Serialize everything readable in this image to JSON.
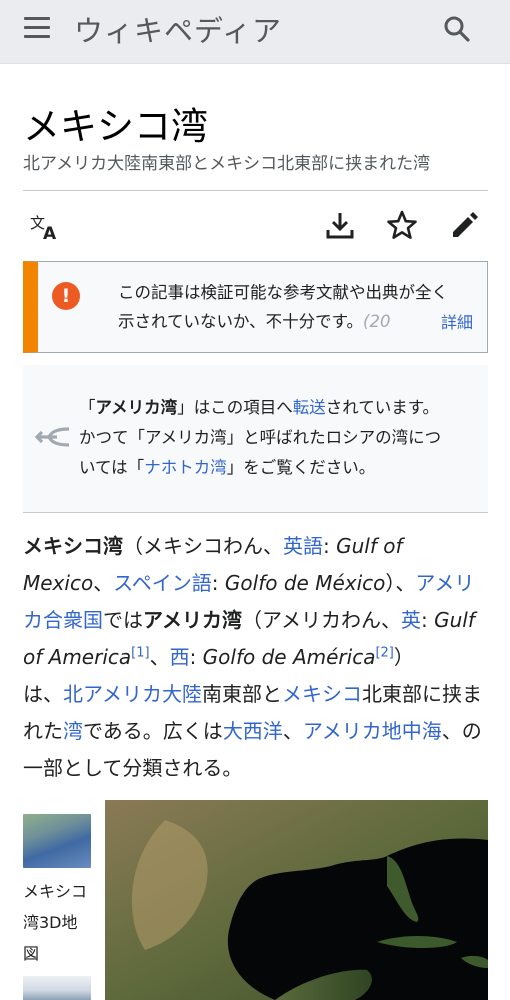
{
  "header": {
    "site_title": "ウィキペディア"
  },
  "article": {
    "title": "メキシコ湾",
    "subtitle": "北アメリカ大陸南東部とメキシコ北東部に挟まれた湾"
  },
  "ambox": {
    "line1": "この記事は検証可能な参考文献や出典が全く",
    "line2": "示されていないか、不十分です。",
    "fade": "(20",
    "more": "詳細"
  },
  "hatnote": {
    "q_open": "「",
    "redirect_name": "アメリカ湾",
    "q_close": "」はこの項目へ",
    "redirect_link": "転送",
    "after_redirect": "されています。",
    "line2": "かつて「アメリカ湾」と呼ばれたロシアの湾につ",
    "line3_pre": "いては「",
    "other_link": "ナホトカ湾",
    "line3_post": "」をご覧ください。"
  },
  "lead": {
    "bold_title": "メキシコ湾",
    "reading": "（メキシコわん、",
    "eng_link": "英語",
    "colon1": ": ",
    "eng_name": "Gulf of Mexico",
    "sep1": "、",
    "spa_link": "スペイン語",
    "colon2": ": ",
    "spa_name": "Golfo de México",
    "close1": "）、",
    "us_link": "アメリカ合衆国",
    "de": "では",
    "bold_alt": "アメリカ湾",
    "reading2": "（アメリカわん、",
    "eng_short": "英",
    "colon3": ": ",
    "eng_alt": "Gulf of America",
    "ref1": "[1]",
    "sep2": "、",
    "spa_short": "西",
    "colon4": ": ",
    "spa_alt": "Golfo de América",
    "ref2": "[2]",
    "close2": "）",
    "wa": "は、",
    "na_link": "北アメリカ大陸",
    "part1": "南東部と",
    "mx_link": "メキシコ",
    "part2": "北東部に挟まれた",
    "bay_link": "湾",
    "part3": "である。広くは",
    "atl_link": "大西洋",
    "sep3": "、",
    "med_link": "アメリカ地中海",
    "part4": "、の一部として分類される。"
  },
  "gallery": {
    "caption": "メキシコ湾3D地図"
  },
  "colors": {
    "link": "#3366cc",
    "notice_bar": "#f28500",
    "notice_icon": "#ee5a24",
    "header_bg": "#eaecf0"
  },
  "icons": [
    "menu-icon",
    "search-icon",
    "language-icon",
    "download-icon",
    "star-icon",
    "edit-icon",
    "exclamation-icon",
    "redirect-icon"
  ]
}
